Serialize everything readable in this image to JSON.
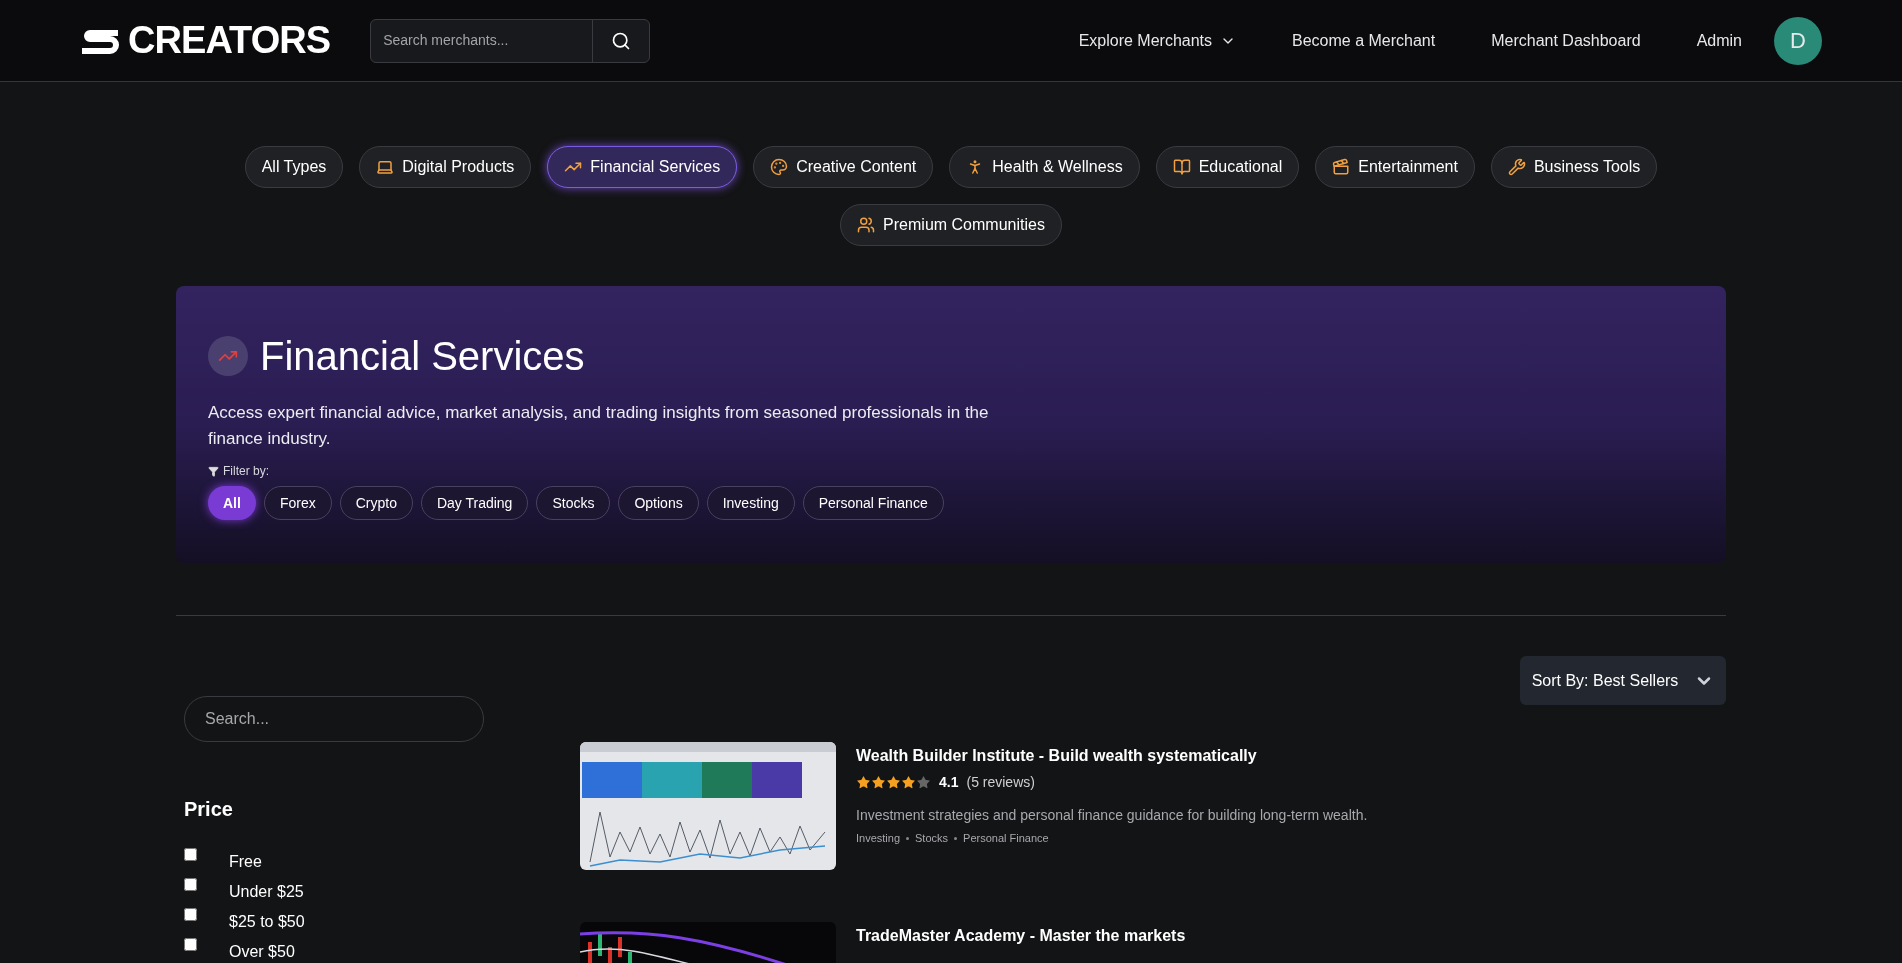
{
  "header": {
    "logo": "CREATORS",
    "search": {
      "placeholder": "Search merchants..."
    },
    "nav": [
      {
        "label": "Explore Merchants",
        "kind": "dropdown"
      },
      {
        "label": "Become a Merchant",
        "kind": "link"
      },
      {
        "label": "Merchant Dashboard",
        "kind": "link"
      },
      {
        "label": "Admin",
        "kind": "link"
      }
    ],
    "avatar": "D"
  },
  "categories": [
    {
      "label": "All Types",
      "selected": false
    },
    {
      "label": "Digital Products",
      "selected": false
    },
    {
      "label": "Financial Services",
      "selected": true
    },
    {
      "label": "Creative Content",
      "selected": false
    },
    {
      "label": "Health & Wellness",
      "selected": false
    },
    {
      "label": "Educational",
      "selected": false
    },
    {
      "label": "Entertainment",
      "selected": false
    },
    {
      "label": "Business Tools",
      "selected": false
    },
    {
      "label": "Premium Communities",
      "selected": false
    }
  ],
  "banner": {
    "title": "Financial Services",
    "description": "Access expert financial advice, market analysis, and trading insights from seasoned professionals in the finance industry.",
    "filter_label": "Filter by:",
    "filters": [
      {
        "label": "All",
        "selected": true
      },
      {
        "label": "Forex",
        "selected": false
      },
      {
        "label": "Crypto",
        "selected": false
      },
      {
        "label": "Day Trading",
        "selected": false
      },
      {
        "label": "Stocks",
        "selected": false
      },
      {
        "label": "Options",
        "selected": false
      },
      {
        "label": "Investing",
        "selected": false
      },
      {
        "label": "Personal Finance",
        "selected": false
      }
    ]
  },
  "sort": "Sort By: Best Sellers",
  "sidebar": {
    "search": {
      "placeholder": "Search..."
    },
    "price": {
      "title": "Price",
      "options": [
        {
          "label": "Free",
          "checked": false
        },
        {
          "label": "Under $25",
          "checked": false
        },
        {
          "label": "$25 to $50",
          "checked": false
        },
        {
          "label": "Over $50",
          "checked": false
        }
      ]
    }
  },
  "products": [
    {
      "title": "Wealth Builder Institute - Build wealth systematically",
      "stars": 4,
      "rating": "4.1",
      "reviews": "(5 reviews)",
      "description": "Investment strategies and personal finance guidance for building long-term wealth.",
      "tags": [
        "Investing",
        "Stocks",
        "Personal Finance"
      ],
      "kind": "picture"
    },
    {
      "title": "TradeMaster Academy - Master the markets",
      "kind": "picture"
    }
  ]
}
